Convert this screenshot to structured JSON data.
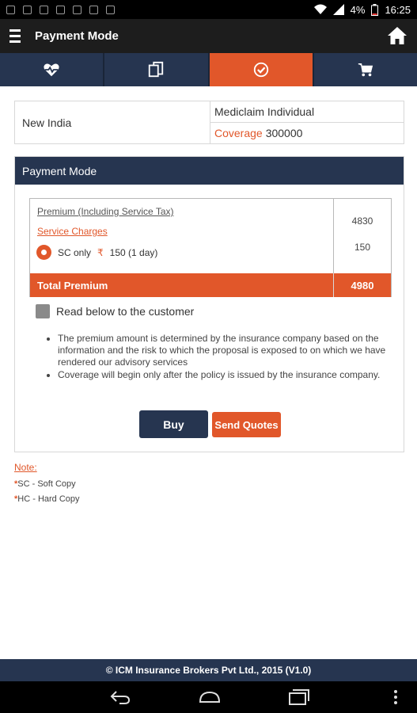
{
  "status_bar": {
    "battery_percent": "4%",
    "time": "16:25"
  },
  "app_bar": {
    "title": "Payment Mode"
  },
  "tabs": [
    {
      "icon": "heartbeat-icon",
      "active": false
    },
    {
      "icon": "documents-icon",
      "active": false
    },
    {
      "icon": "check-circle-icon",
      "active": true
    },
    {
      "icon": "cart-icon",
      "active": false
    }
  ],
  "policy": {
    "insurer": "New India",
    "plan": "Mediclaim Individual",
    "coverage_label": "Coverage",
    "coverage_value": "300000"
  },
  "payment": {
    "title": "Payment Mode",
    "premium_label": "Premium (Including Service Tax)",
    "premium_value": "4830",
    "service_label": "Service Charges",
    "service_value": "150",
    "sc_text_before": "SC only",
    "rupee": "₹",
    "sc_text_after": "150 (1 day)",
    "total_label": "Total Premium",
    "total_value": "4980",
    "read_label": "Read below to the customer",
    "notes": [
      "The premium amount is determined by the insurance company based on the information and the risk to which the proposal is exposed to on which we have rendered our advisory services",
      "Coverage will begin only after the policy is issued by the insurance company."
    ],
    "buy_label": "Buy",
    "quote_label": "Send Quotes"
  },
  "legend": {
    "note_label": "Note:",
    "sc_code": "SC",
    "sc_text": "Soft Copy",
    "hc_code": "HC",
    "hc_text": "Hard Copy"
  },
  "footer": {
    "text": "© ICM Insurance Brokers Pvt Ltd., 2015 (V1.0)"
  },
  "colors": {
    "accent": "#e1572a",
    "navy": "#263550"
  }
}
